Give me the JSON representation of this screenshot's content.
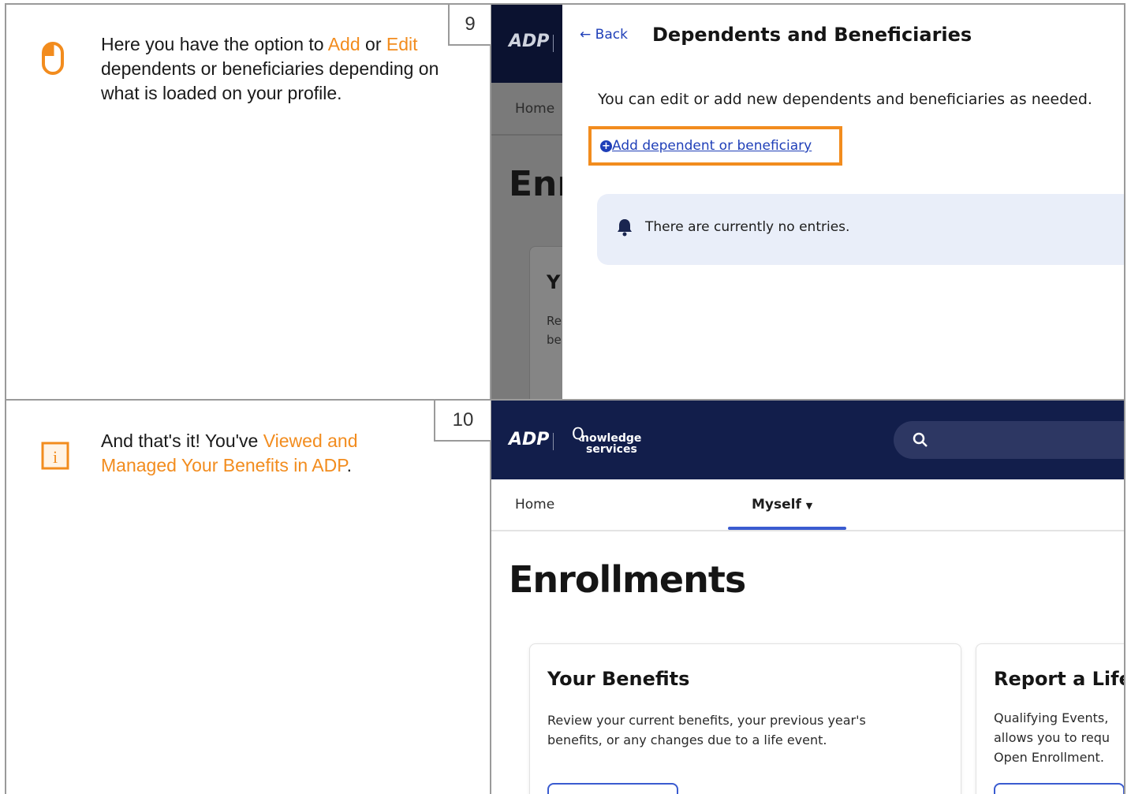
{
  "steps": [
    {
      "number": "9",
      "text_parts": [
        "Here you have the option to ",
        "Add",
        " or ",
        "Edit",
        " dependents or beneficiaries depending on what is loaded on your profile."
      ],
      "icon": "mouse-click-icon",
      "screenshot": {
        "back_label": "Back",
        "title": "Dependents and Beneficiaries",
        "subtitle": "You can edit or add new dependents and beneficiaries as needed.",
        "add_link": "Add dependent or beneficiary",
        "empty_message": "There are currently no entries.",
        "bg_nav_home": "Home",
        "bg_heading_partial": "Enr",
        "bg_card_partial": "Y",
        "bg_text_partial_1": "Re",
        "bg_text_partial_2": "be"
      }
    },
    {
      "number": "10",
      "text_parts": [
        "And that's it! You've ",
        "Viewed and Managed Your Benefits in ADP",
        "."
      ],
      "icon": "info-icon",
      "screenshot": {
        "brand_top": "nowledge",
        "brand_bottom": "services",
        "nav_home": "Home",
        "nav_myself": "Myself",
        "heading": "Enrollments",
        "card1_title": "Your Benefits",
        "card1_text": "Review your current benefits, your previous year's benefits, or any changes due to a life event.",
        "card2_title": "Report a Life",
        "card2_text_1": "Qualifying Events,",
        "card2_text_2": "allows you to requ",
        "card2_text_3": "Open Enrollment."
      }
    }
  ],
  "colors": {
    "accent": "#f28c1e",
    "navy": "#121e4b",
    "link": "#1f3fb8"
  }
}
